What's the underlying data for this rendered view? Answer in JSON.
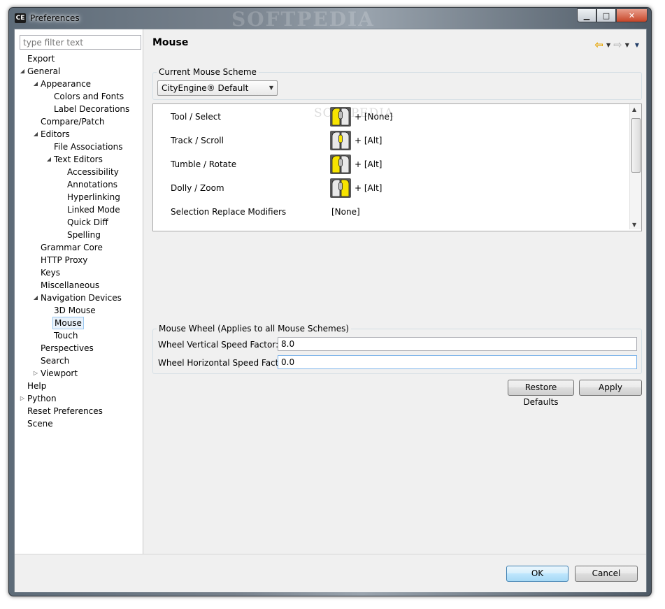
{
  "window": {
    "app_badge": "CE",
    "title": "Preferences",
    "watermark": "SOFTPEDIA",
    "controls": {
      "minimize": "▁",
      "maximize": "□",
      "close": "✕"
    }
  },
  "sidebar": {
    "filter_placeholder": "type filter text",
    "tree": [
      {
        "label": "Export",
        "depth": 0,
        "toggle": ""
      },
      {
        "label": "General",
        "depth": 0,
        "toggle": "expanded"
      },
      {
        "label": "Appearance",
        "depth": 1,
        "toggle": "expanded"
      },
      {
        "label": "Colors and Fonts",
        "depth": 2,
        "toggle": ""
      },
      {
        "label": "Label Decorations",
        "depth": 2,
        "toggle": ""
      },
      {
        "label": "Compare/Patch",
        "depth": 1,
        "toggle": ""
      },
      {
        "label": "Editors",
        "depth": 1,
        "toggle": "expanded"
      },
      {
        "label": "File Associations",
        "depth": 2,
        "toggle": ""
      },
      {
        "label": "Text Editors",
        "depth": 2,
        "toggle": "expanded"
      },
      {
        "label": "Accessibility",
        "depth": 3,
        "toggle": ""
      },
      {
        "label": "Annotations",
        "depth": 3,
        "toggle": ""
      },
      {
        "label": "Hyperlinking",
        "depth": 3,
        "toggle": ""
      },
      {
        "label": "Linked Mode",
        "depth": 3,
        "toggle": ""
      },
      {
        "label": "Quick Diff",
        "depth": 3,
        "toggle": ""
      },
      {
        "label": "Spelling",
        "depth": 3,
        "toggle": ""
      },
      {
        "label": "Grammar Core",
        "depth": 1,
        "toggle": ""
      },
      {
        "label": "HTTP Proxy",
        "depth": 1,
        "toggle": ""
      },
      {
        "label": "Keys",
        "depth": 1,
        "toggle": ""
      },
      {
        "label": "Miscellaneous",
        "depth": 1,
        "toggle": ""
      },
      {
        "label": "Navigation Devices",
        "depth": 1,
        "toggle": "expanded"
      },
      {
        "label": "3D Mouse",
        "depth": 2,
        "toggle": ""
      },
      {
        "label": "Mouse",
        "depth": 2,
        "toggle": "",
        "selected": true
      },
      {
        "label": "Touch",
        "depth": 2,
        "toggle": ""
      },
      {
        "label": "Perspectives",
        "depth": 1,
        "toggle": ""
      },
      {
        "label": "Search",
        "depth": 1,
        "toggle": ""
      },
      {
        "label": "Viewport",
        "depth": 1,
        "toggle": "collapsed"
      },
      {
        "label": "Help",
        "depth": 0,
        "toggle": ""
      },
      {
        "label": "Python",
        "depth": 0,
        "toggle": "collapsed"
      },
      {
        "label": "Reset Preferences",
        "depth": 0,
        "toggle": ""
      },
      {
        "label": "Scene",
        "depth": 0,
        "toggle": ""
      }
    ]
  },
  "page": {
    "title": "Mouse",
    "scheme_group_label": "Current Mouse Scheme",
    "scheme_selected": "CityEngine® Default",
    "scheme_rows": [
      {
        "action": "Tool / Select",
        "button": "left",
        "modifier": "+ [None]"
      },
      {
        "action": "Track / Scroll",
        "button": "middle",
        "modifier": "+ [Alt]"
      },
      {
        "action": "Tumble / Rotate",
        "button": "left",
        "modifier": "+ [Alt]"
      },
      {
        "action": "Dolly / Zoom",
        "button": "right",
        "modifier": "+ [Alt]"
      },
      {
        "action": "Selection Replace Modifiers",
        "button": "",
        "modifier": "[None]"
      }
    ],
    "list_watermark": "SOFTPEDIA",
    "wheel_group_label": "Mouse Wheel (Applies to all Mouse Schemes)",
    "wheel_vertical_label": "Wheel Vertical Speed Factor:",
    "wheel_vertical_value": "8.0",
    "wheel_horizontal_label": "Wheel Horizontal Speed Factor:",
    "wheel_horizontal_value": "0.0",
    "restore_defaults_label": "Restore Defaults",
    "apply_label": "Apply"
  },
  "footer": {
    "ok_label": "OK",
    "cancel_label": "Cancel"
  },
  "colors": {
    "mouse_button_highlight": "#f7e400",
    "selection_fill": "#e9f2fb",
    "selection_border": "#99c7f0",
    "default_button_border": "#3c7fb1"
  }
}
